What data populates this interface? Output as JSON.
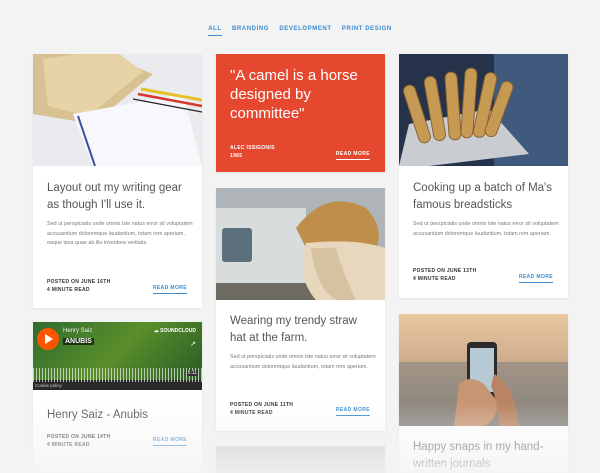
{
  "filters": [
    "ALL",
    "BRANDING",
    "DEVELOPMENT",
    "PRINT DESIGN"
  ],
  "cards": {
    "writing": {
      "title": "Layout out my writing gear as though I'll use it.",
      "text": "Sed ut perspiciatis unde omnis iste natus error sit voluptatem accusantium doloremque laudantium, totam rem aperiam, eaque ipsa quae ab illo inventore veritatis.",
      "posted": "POSTED ON JUNE 16TH",
      "read": "4 MINUTE READ",
      "more": "READ MORE"
    },
    "quote": {
      "quote": "\"A camel is a horse designed by committee\"",
      "author": "ALEC ISSIGONIS",
      "year": "1965",
      "more": "READ MORE"
    },
    "bread": {
      "title": "Cooking up a batch of Ma's famous breadsticks",
      "text": "Sed ut perspiciatis unde omnis iste natus error sit voluptatem accusantium doloremque laudantium, totam rem aperiam.",
      "posted": "POSTED ON JUNE 13TH",
      "read": "4 MINUTE READ",
      "more": "READ MORE"
    },
    "straw": {
      "title": "Wearing my trendy straw hat at the farm.",
      "text": "Sed ut perspiciatis unde omnis iste natus error sit voluptatem accusantium doloremque laudantium, totam rem aperiam.",
      "posted": "POSTED ON JUNE 11TH",
      "read": "4 MINUTE READ",
      "more": "READ MORE"
    },
    "henry": {
      "player_user": "Henry Saiz",
      "player_track": "ANUBIS",
      "player_brand": "SOUNDCLOUD",
      "player_time": "5:11",
      "cookie": "Cookie policy",
      "title": "Henry Saiz - Anubis",
      "posted": "POSTED ON JUNE 14TH",
      "read": "4 MINUTE READ",
      "more": "READ MORE"
    },
    "snaps": {
      "title": "Happy snaps in my hand-written journals"
    }
  },
  "colors": {
    "accent": "#3a8bd0",
    "quote_bg": "#e5482f",
    "background": "#f3f3f3"
  }
}
